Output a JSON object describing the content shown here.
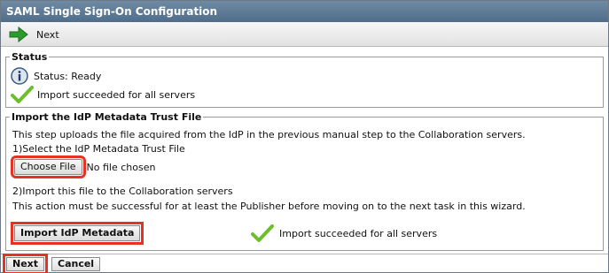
{
  "window": {
    "title": "SAML Single Sign-On Configuration"
  },
  "toolbar": {
    "next_label": "Next"
  },
  "status": {
    "legend": "Status",
    "status_text": "Status: Ready",
    "import_result": "Import succeeded for all servers"
  },
  "import_section": {
    "legend": "Import the IdP Metadata Trust File",
    "description": "This step uploads the file acquired from the IdP in the previous manual step to the Collaboration servers.",
    "step1_label": "1)Select the IdP Metadata Trust File",
    "choose_file_label": "Choose File",
    "file_status": "No file chosen",
    "step2_label": "2)Import this file to the Collaboration servers",
    "step2_note": "This action must be successful for at least the Publisher before moving on to the next task in this wizard.",
    "import_button_label": "Import IdP Metadata",
    "import_result": "Import succeeded for all servers"
  },
  "footer": {
    "next_label": "Next",
    "cancel_label": "Cancel"
  },
  "colors": {
    "highlight": "#e53223",
    "titlebar": "#5a7894",
    "check": "#6cbf2a"
  }
}
